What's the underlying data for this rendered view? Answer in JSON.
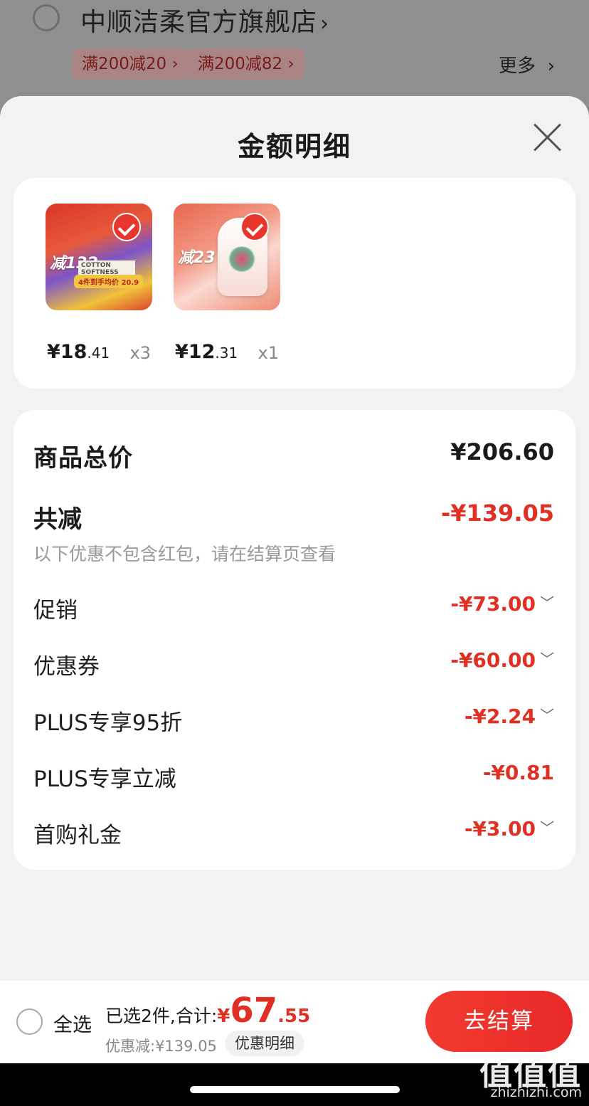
{
  "store": {
    "name": "中顺洁柔官方旗舰店",
    "promos": [
      "满200减20",
      "满200减82"
    ],
    "more": "更多"
  },
  "sheet": {
    "title": "金额明细"
  },
  "products": [
    {
      "price_int": "¥18",
      "price_dec": ".41",
      "qty": "x3",
      "img_big": "减132",
      "img_mid": "COTTON SOFTNESS",
      "img_strip": "4件到手均价 20.9",
      "selected": true
    },
    {
      "price_int": "¥12",
      "price_dec": ".31",
      "qty": "x1",
      "img_big": "减23",
      "selected": true
    }
  ],
  "summary": {
    "total_label": "商品总价",
    "total_value": "¥206.60",
    "reduce_label": "共减",
    "reduce_value": "-¥139.05",
    "hint": "以下优惠不包含红包，请在结算页查看",
    "items": [
      {
        "label": "促销",
        "value": "-¥73.00",
        "expandable": true
      },
      {
        "label": "优惠券",
        "value": "-¥60.00",
        "expandable": true
      },
      {
        "label": "PLUS专享95折",
        "value": "-¥2.24",
        "expandable": true
      },
      {
        "label": "PLUS专享立减",
        "value": "-¥0.81",
        "expandable": false
      },
      {
        "label": "首购礼金",
        "value": "-¥3.00",
        "expandable": true
      }
    ]
  },
  "footer": {
    "select_all": "全选",
    "sum_prefix": "已选2件,合计:",
    "sum_yen": "¥",
    "sum_int": "67",
    "sum_dec": ".55",
    "saved": "优惠减:¥139.05",
    "detail_chip": "优惠明细",
    "checkout": "去结算"
  },
  "watermark": {
    "logo": "值值值",
    "url": "zhizhizhi.com"
  },
  "colors": {
    "accent_red": "#e03024",
    "checkout_red": "#f23a2f"
  }
}
